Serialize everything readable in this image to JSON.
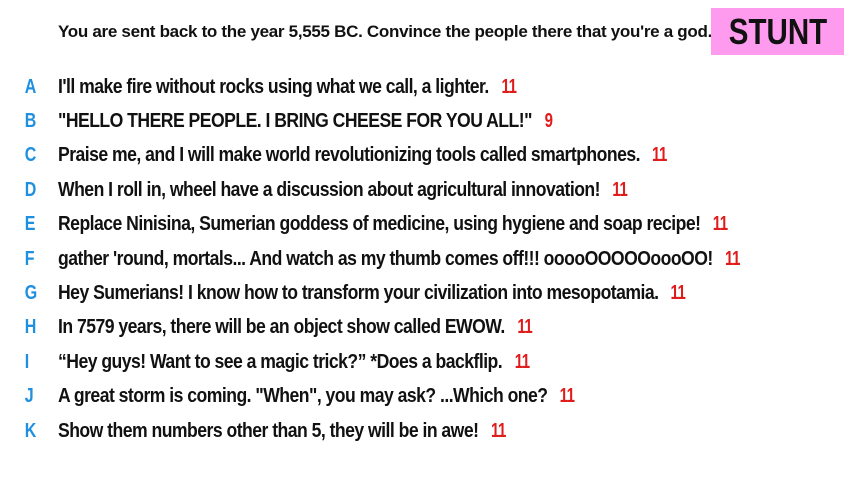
{
  "prompt": "You are sent back to the year 5,555 BC. Convince the people there that you're a god.",
  "badge": {
    "label": "STUNT",
    "color": "#ff9bee"
  },
  "colors": {
    "letter": "#1f8fe0",
    "score": "#e01b1b",
    "text": "#111111"
  },
  "answers": [
    {
      "letter": "A",
      "text": "I'll make fire without rocks using what we call, a lighter.",
      "score": "11"
    },
    {
      "letter": "B",
      "text": "\"HELLO THERE PEOPLE. I BRING CHEESE FOR YOU ALL!\"",
      "score": "9"
    },
    {
      "letter": "C",
      "text": "Praise me, and I will make world revolutionizing tools called smartphones.",
      "score": "11"
    },
    {
      "letter": "D",
      "text": "When I roll in, wheel have a discussion about agricultural innovation!",
      "score": "11"
    },
    {
      "letter": "E",
      "text": "Replace Ninisina, Sumerian goddess of medicine, using hygiene and soap recipe!",
      "score": "11"
    },
    {
      "letter": "F",
      "text": "gather 'round, mortals... And watch as my thumb comes off!!! ooooOOOOOoooOO!",
      "score": "11"
    },
    {
      "letter": "G",
      "text": "Hey Sumerians! I know how to transform your civilization into mesopotamia.",
      "score": "11"
    },
    {
      "letter": "H",
      "text": "In 7579 years, there will be an object show called EWOW.",
      "score": "11"
    },
    {
      "letter": "I",
      "text": "“Hey guys! Want to see a magic trick?” *Does a backflip.",
      "score": "11"
    },
    {
      "letter": "J",
      "text": "A great storm is coming. \"When\", you may ask? ...Which one?",
      "score": "11"
    },
    {
      "letter": "K",
      "text": "Show them numbers other than 5, they will be in awe!",
      "score": "11"
    }
  ]
}
